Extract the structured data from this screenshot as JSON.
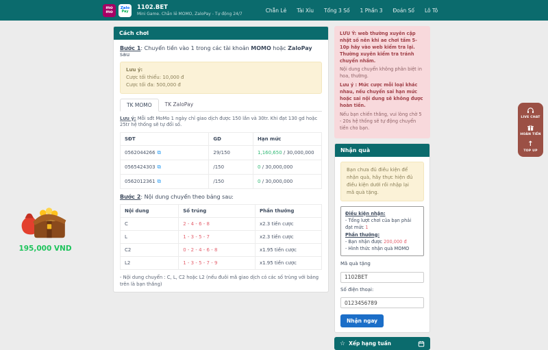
{
  "header": {
    "title": "1102.BET",
    "subtitle": "Mini Game. Chẵn lẻ MOMO, ZaloPay - Tự động 24/7",
    "logo_momo_line1": "mo",
    "logo_momo_line2": "mo",
    "logo_zalo_line1": "Zalo",
    "logo_zalo_line2": "Pay",
    "nav": [
      "Chẵn Lẻ",
      "Tài Xỉu",
      "Tổng 3 Số",
      "1 Phần 3",
      "Đoán Số",
      "Lô Tô"
    ]
  },
  "how_to_play": {
    "title": "Cách chơi",
    "step1": {
      "label": "Bước 1",
      "before": ": Chuyển tiền vào 1 trong các tài khoản ",
      "momo": "MOMO",
      "middle": " hoặc ",
      "zalopay": "ZaloPay",
      "after": " sau"
    },
    "limits_note": {
      "line1": "Lưu ý:",
      "line2": "Cược tối thiểu: 10,000 đ",
      "line3": "Cược tối đa: 500,000 đ"
    },
    "tabs": [
      "TK MOMO",
      "TK ZaloPay"
    ],
    "accounts_note": {
      "label": "Lưu ý:",
      "text": " Mỗi sđt MoMo 1 ngày chỉ giao dịch được 150 lần và 30tr. Khi đạt 130 gd hoặc 25tr hệ thống sẽ tự đổi số."
    },
    "accounts_table": {
      "headers": [
        "SĐT",
        "GD",
        "Hạn mức"
      ],
      "rows": [
        {
          "phone": "0562044266",
          "gd": "29/150",
          "used": "1,160,650",
          "limit": " / 30,000,000"
        },
        {
          "phone": "0565424303",
          "gd": "/150",
          "used": "0",
          "limit": " / 30,000,000"
        },
        {
          "phone": "0562012361",
          "gd": "/150",
          "used": "0",
          "limit": " / 30,000,000"
        }
      ]
    },
    "step2": {
      "label": "Bước 2",
      "text": ": Nội dung chuyển theo bảng sau:"
    },
    "rewards_table": {
      "headers": [
        "Nội dung",
        "Số trúng",
        "Phần thưởng"
      ],
      "rows": [
        {
          "content": "C",
          "numbers": "2 - 4 - 6 - 8",
          "reward": "x2.3 tiền cược"
        },
        {
          "content": "L",
          "numbers": "1 - 3 - 5 - 7",
          "reward": "x2.3 tiền cược"
        },
        {
          "content": "C2",
          "numbers": "0 - 2 - 4 - 6 - 8",
          "reward": "x1.95 tiền cược"
        },
        {
          "content": "L2",
          "numbers": "1 - 3 - 5 - 7 - 9",
          "reward": "x1.95 tiền cược"
        }
      ]
    },
    "footer_note": "- Nội dung chuyển : C, L, C2 hoặc L2 (nếu đuôi mã giao dịch có các số trùng với bảng trên là bạn thắng)"
  },
  "notice": {
    "bold1": "LƯU Ý: web thường xuyên cập nhật số nên khi ae chơi tầm 5-10p hãy vào web kiểm tra lại. Thường xuyên kiểm tra tránh chuyển nhầm.",
    "normal1": "Nội dung chuyển không phân biệt in hoa, thường.",
    "bold2": "Lưu ý : Mức cược mỗi loại khác nhau, nếu chuyển sai hạn mức hoặc sai nội dung sẽ không được hoàn tiền.",
    "normal2": "Nếu bạn chiến thắng, vui lòng chờ 5 - 20s hệ thống sẽ tự động chuyển tiền cho bạn."
  },
  "gift_panel": {
    "title": "Nhận quà",
    "warning": "Bạn chưa đủ điều kiện để nhận quà, hãy thực hiện đủ điều kiện dưới rồi nhập lại mã quà tặng.",
    "conditions_title": "Điều kiện nhận:",
    "condition_prefix": "- Tổng lượt chơi của bạn phải đạt mức ",
    "condition_value": "1",
    "reward_title": "Phần thưởng:",
    "reward_prefix": "- Bạn nhận được ",
    "reward_value": "200,000 đ",
    "reward_method": "- Hình thức nhận quà MOMO",
    "gift_code_label": "Mã quà tặng",
    "gift_code_value": "1102BET",
    "phone_label": "Số điện thoại:",
    "phone_value": "0123456789",
    "submit_label": "Nhận ngay"
  },
  "ranking_bar": {
    "star": "☆",
    "label": "Xếp hạng tuần"
  },
  "side_widget": {
    "items": [
      {
        "icon": "headset-icon",
        "label": "LIVE CHAT"
      },
      {
        "icon": "gift-icon",
        "label": "HOÀN TIỀN"
      },
      {
        "icon": "arrow-up-icon",
        "label": "TOP UP"
      }
    ]
  },
  "bonus": {
    "amount": "195,000 VND"
  },
  "colors": {
    "teal": "#0b6b6d",
    "momo_pink": "#a50064",
    "button_blue": "#1b6ec8",
    "green": "#2eb873",
    "red": "#e4606d",
    "widget_maroon": "#944236"
  }
}
